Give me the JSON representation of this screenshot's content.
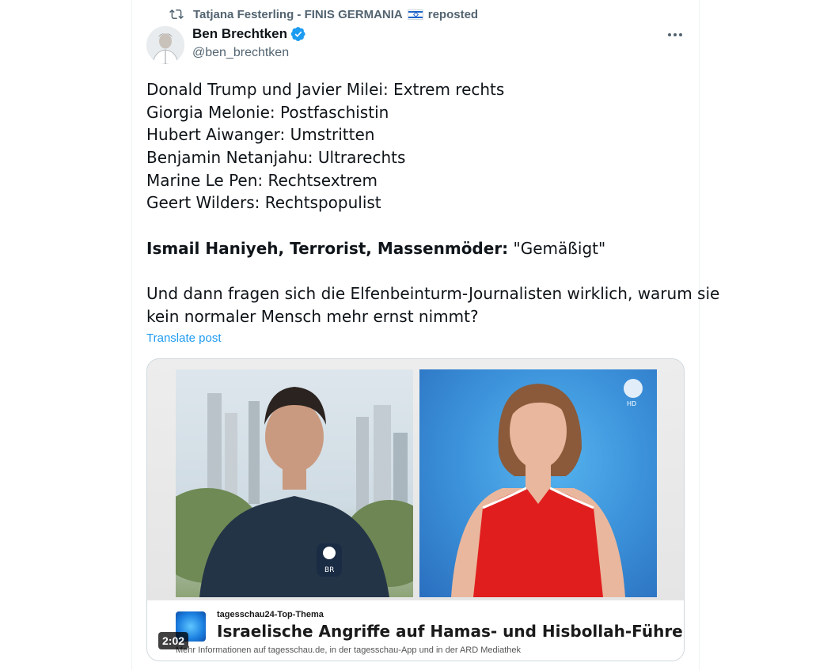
{
  "repost": {
    "reposter": "Tatjana Festerling - FINIS GERMANIA",
    "suffix": "reposted",
    "icons": [
      "repost-icon",
      "israel-flag-icon"
    ]
  },
  "author": {
    "display_name": "Ben Brechtken",
    "handle": "@ben_brechtken",
    "verified": true,
    "icons": [
      "verified-badge-icon",
      "more-options-icon"
    ]
  },
  "tweet": {
    "lines": [
      "Donald Trump und Javier Milei: Extrem rechts",
      "Giorgia Melonie: Postfaschistin",
      "Hubert Aiwanger: Umstritten",
      "Benjamin Netanjahu: Ultrarechts",
      "Marine Le Pen: Rechtsextrem",
      "Geert Wilders: Rechtspopulist"
    ],
    "highlight_bold": "Ismail Haniyeh, Terrorist, Massenmöder:",
    "highlight_rest": " \"Gemäßigt\"",
    "closing_line_1": "Und dann fragen sich die Elfenbeinturm-Journalisten wirklich, warum sie",
    "closing_line_2": "kein normaler Mensch mehr ernst nimmt?",
    "translate_label": "Translate post"
  },
  "video": {
    "kicker": "tagesschau24-Top-Thema",
    "title": "Israelische Angriffe auf Hamas- und Hisbollah-Führer",
    "info": "Mehr Informationen auf tagesschau.de, in der tagesschau-App und in der ARD Mediathek",
    "duration": "2:02",
    "channel_badge": "HD",
    "mic_label": "BR"
  },
  "colors": {
    "accent": "#1d9bf0",
    "secondary_text": "#536471",
    "primary_text": "#0f1419",
    "border": "#cfd9de"
  }
}
